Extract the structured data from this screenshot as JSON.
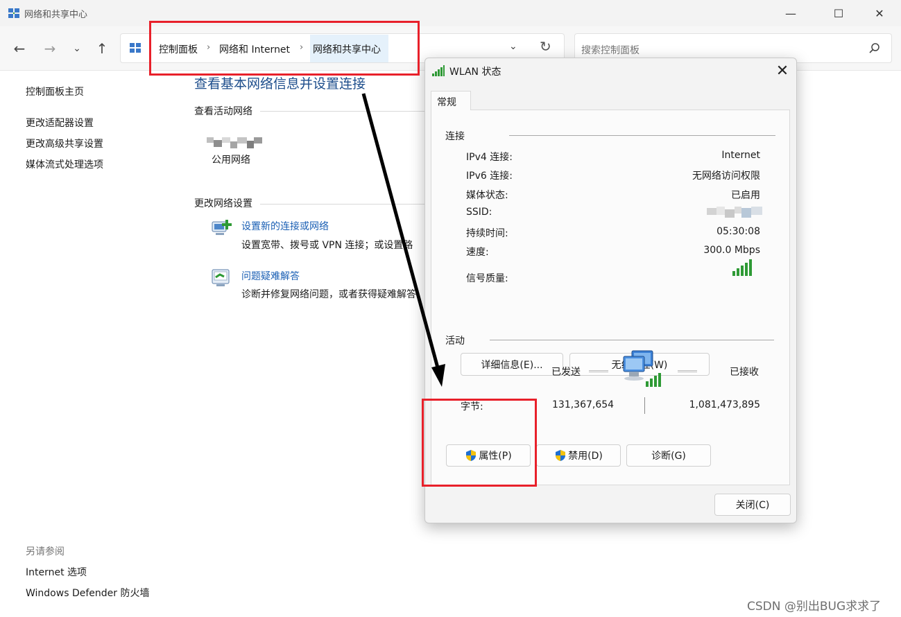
{
  "window": {
    "title": "网络和共享中心",
    "controls": {
      "minimize": "—",
      "maximize": "☐",
      "close": "✕"
    }
  },
  "nav": {
    "back": "←",
    "forward": "→",
    "recent": "⌄",
    "up": "↑",
    "breadcrumbs": [
      "控制面板",
      "网络和 Internet",
      "网络和共享中心"
    ],
    "separator": "›",
    "dropdown": "⌄",
    "refresh": "↻"
  },
  "search": {
    "placeholder": "搜索控制面板"
  },
  "sidebar": {
    "items": [
      "控制面板主页",
      "更改适配器设置",
      "更改高级共享设置",
      "媒体流式处理选项"
    ],
    "see_also_label": "另请参阅",
    "see_also": [
      "Internet 选项",
      "Windows Defender 防火墙"
    ]
  },
  "main": {
    "title": "查看基本网络信息并设置连接",
    "active_networks_title": "查看活动网络",
    "network_type": "公用网络",
    "change_settings_title": "更改网络设置",
    "tasks": [
      {
        "link": "设置新的连接或网络",
        "desc": "设置宽带、拨号或 VPN 连接；或设置路"
      },
      {
        "link": "问题疑难解答",
        "desc": "诊断并修复网络问题，或者获得疑难解答"
      }
    ]
  },
  "dialog": {
    "title": "WLAN 状态",
    "close": "✕",
    "tab": "常规",
    "connection": {
      "label": "连接",
      "rows": [
        {
          "label": "IPv4 连接:",
          "value": "Internet"
        },
        {
          "label": "IPv6 连接:",
          "value": "无网络访问权限"
        },
        {
          "label": "媒体状态:",
          "value": "已启用"
        },
        {
          "label": "SSID:",
          "value": ""
        },
        {
          "label": "持续时间:",
          "value": "05:30:08"
        },
        {
          "label": "速度:",
          "value": "300.0 Mbps"
        }
      ],
      "signal_label": "信号质量:"
    },
    "buttons": {
      "details": "详细信息(E)...",
      "wireless_props": "无线属性(W)"
    },
    "activity": {
      "label": "活动",
      "sent_label": "已发送",
      "received_label": "已接收",
      "bytes_label": "字节:",
      "bytes_sent": "131,367,654",
      "bytes_received": "1,081,473,895"
    },
    "action_buttons": {
      "properties": "属性(P)",
      "disable": "禁用(D)",
      "diagnose": "诊断(G)"
    },
    "close_button": "关闭(C)"
  },
  "watermark": "CSDN @别出BUG求求了",
  "colors": {
    "annotation_red": "#e8202a",
    "link_blue": "#1a5fb4",
    "title_blue": "#1e4e8c",
    "signal_green": "#2e9a35",
    "shield_blue": "#1f6fd1",
    "shield_yellow": "#f4c20d"
  }
}
